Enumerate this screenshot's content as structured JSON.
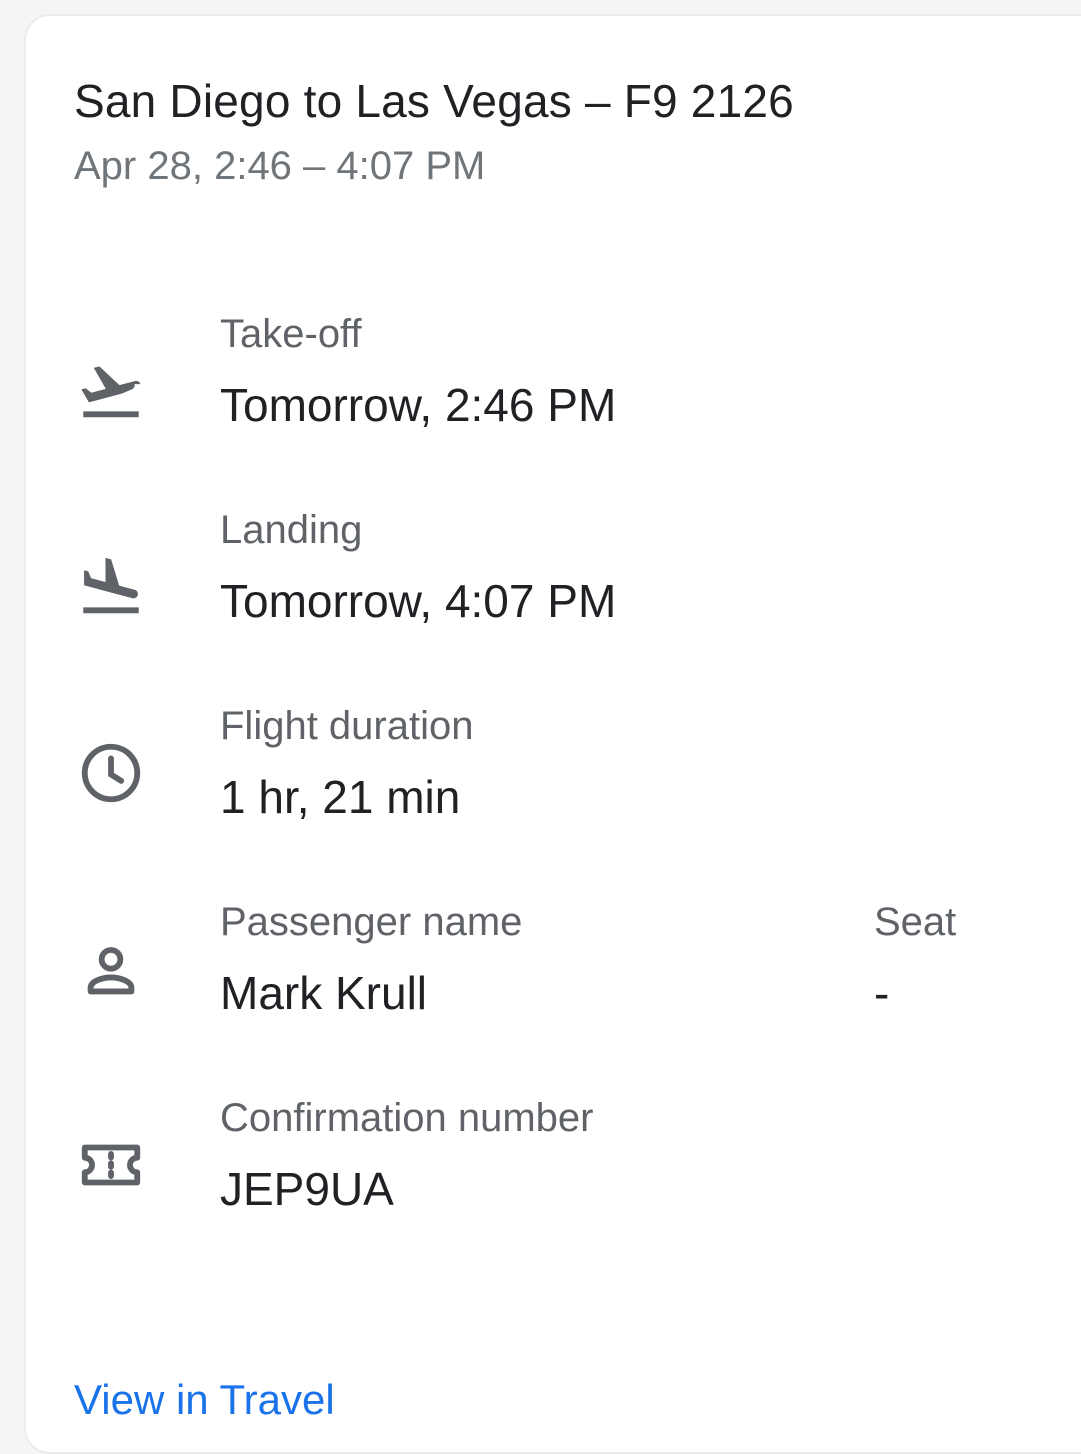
{
  "card": {
    "title": "San Diego to Las Vegas – F9 2126",
    "subtitle": "Apr 28, 2:46 – 4:07 PM"
  },
  "rows": {
    "takeoff": {
      "icon": "flight-takeoff-icon",
      "label": "Take-off",
      "value": "Tomorrow, 2:46 PM"
    },
    "landing": {
      "icon": "flight-land-icon",
      "label": "Landing",
      "value": "Tomorrow, 4:07 PM"
    },
    "duration": {
      "icon": "clock-icon",
      "label": "Flight duration",
      "value": "1 hr, 21 min"
    },
    "passenger": {
      "icon": "person-icon",
      "label": "Passenger name",
      "value": "Mark Krull"
    },
    "seat": {
      "label": "Seat",
      "value": "-"
    },
    "confirmation": {
      "icon": "ticket-icon",
      "label": "Confirmation number",
      "value": "JEP9UA"
    }
  },
  "footer": {
    "link_label": "View in Travel"
  },
  "colors": {
    "accent": "#1a73e8",
    "icon": "#5f6368",
    "primary_text": "#202124",
    "secondary_text": "#70757a"
  }
}
